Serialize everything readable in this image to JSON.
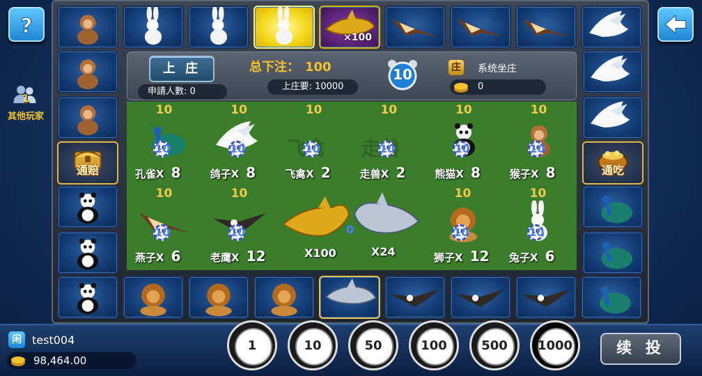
{
  "top_left": {
    "help_icon": "question-mark"
  },
  "top_right": {
    "back_icon": "left-arrow"
  },
  "other_players": {
    "count": "1",
    "label": "其他玩家"
  },
  "panel": {
    "bank_button": "上 庄",
    "applicants": "申請人數: 0",
    "total_bet_label": "总下注：",
    "total_bet_value": "100",
    "bank_required": "上庄要: 10000",
    "timer": "10",
    "banker_badge": "庄",
    "banker_name": "系统坐庄",
    "banker_coins": "0"
  },
  "ring_tiles": [
    {
      "animal": "monkey"
    },
    {
      "animal": "rabbit"
    },
    {
      "animal": "rabbit"
    },
    {
      "animal": "rabbit",
      "state": "highlight"
    },
    {
      "animal": "gold-shark",
      "label": "×100"
    },
    {
      "animal": "swallow"
    },
    {
      "animal": "swallow"
    },
    {
      "animal": "swallow"
    },
    {
      "animal": "dove"
    },
    {
      "animal": "monkey"
    },
    {
      "animal": "monkey"
    },
    {
      "animal": "dove"
    },
    {
      "animal": "dove"
    },
    {
      "animal": "panda"
    },
    {
      "animal": "panda"
    },
    {
      "animal": "peacock"
    },
    {
      "animal": "peacock"
    },
    {
      "animal": "panda"
    },
    {
      "animal": "lion"
    },
    {
      "animal": "lion"
    },
    {
      "animal": "lion"
    },
    {
      "animal": "silver-shark"
    },
    {
      "animal": "eagle"
    },
    {
      "animal": "eagle"
    },
    {
      "animal": "eagle"
    },
    {
      "animal": "peacock"
    }
  ],
  "specials": {
    "left": "通赔",
    "right": "通吃"
  },
  "bets_top": [
    {
      "mul": "10",
      "name": "孔雀X",
      "odds": "8",
      "bet": "10"
    },
    {
      "mul": "10",
      "name": "鸽子X",
      "odds": "8",
      "bet": "10"
    },
    {
      "mul": "10",
      "name": "飞禽X",
      "odds": "2",
      "bet": "10",
      "watermark": "飞禽"
    },
    {
      "mul": "10",
      "name": "走兽X",
      "odds": "2",
      "bet": "10",
      "watermark": "走兽"
    },
    {
      "mul": "10",
      "name": "熊猫X",
      "odds": "8",
      "bet": "10"
    },
    {
      "mul": "10",
      "name": "猴子X",
      "odds": "8",
      "bet": "10"
    }
  ],
  "bets_bottom": [
    {
      "mul": "10",
      "name": "燕子X",
      "odds": "6",
      "bet": "10"
    },
    {
      "mul": "10",
      "name": "老鹰X",
      "odds": "12",
      "bet": "10"
    },
    {
      "mul": "10",
      "name": "狮子X",
      "odds": "12",
      "bet": "10"
    },
    {
      "mul": "10",
      "name": "兔子X",
      "odds": "6",
      "bet": "10"
    }
  ],
  "sharks": {
    "gold": "X100",
    "silver": "X24",
    "bet": "0"
  },
  "chip_small_label": "10",
  "player": {
    "badge": "闲",
    "name": "test004",
    "coins": "98,464.00"
  },
  "chips": [
    "1",
    "10",
    "50",
    "100",
    "500",
    "1000"
  ],
  "repeat_button": "续 投",
  "colors": {
    "gold": "#f2c94c",
    "felt": "#3a7d2a",
    "highlight": "#f5d91b",
    "blue": "#1d86d6"
  }
}
